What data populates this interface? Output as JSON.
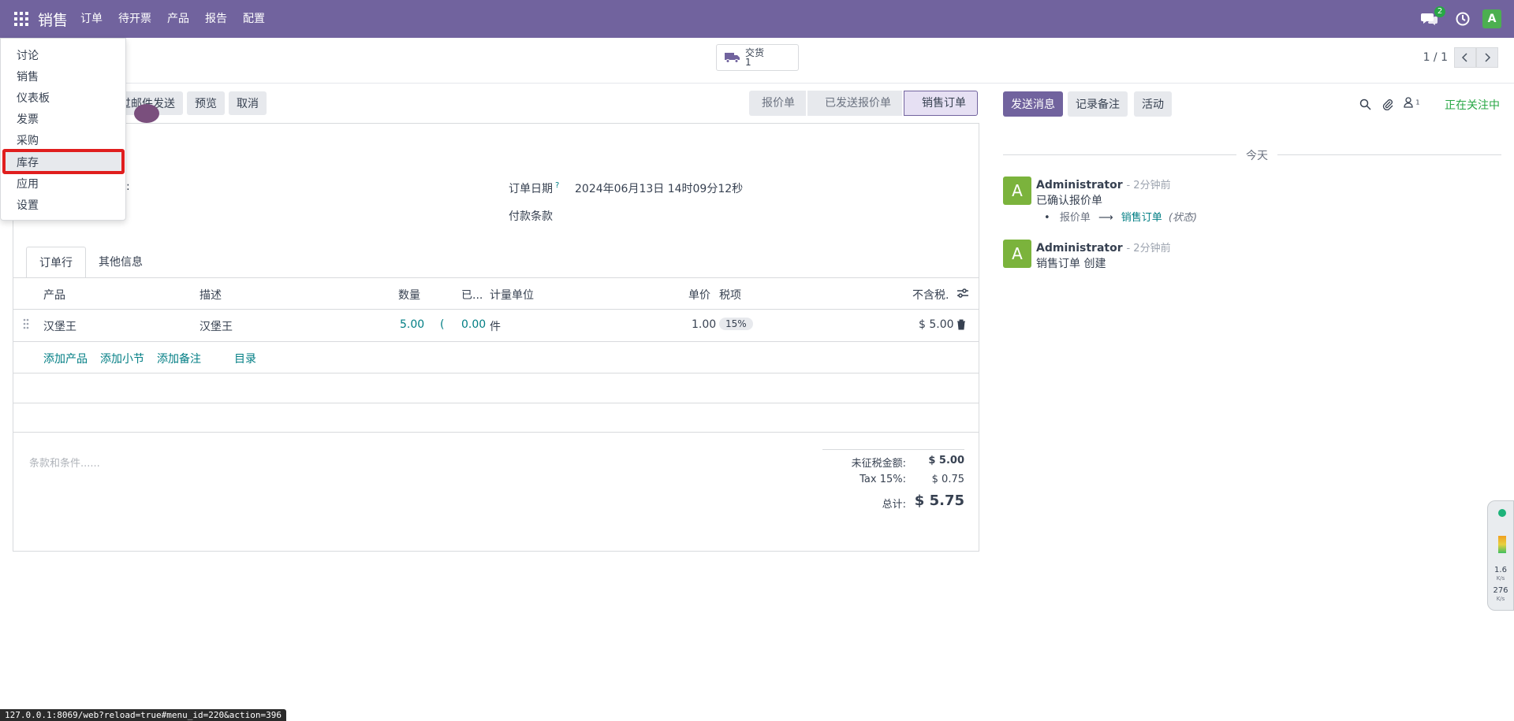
{
  "topbar": {
    "brand": "销售",
    "menu": [
      "订单",
      "待开票",
      "产品",
      "报告",
      "配置"
    ],
    "chat_count": "2",
    "user_initial": "A",
    "accent": "#71639e"
  },
  "control_panel": {
    "smart_button_label": "交货",
    "smart_button_value": "1",
    "pager_value": "1 / 1"
  },
  "statusbar": {
    "email_button": "通过邮件发送",
    "preview_button": "预览",
    "cancel_button": "取消",
    "stages": [
      "报价单",
      "已发送报价单",
      "销售订单"
    ],
    "active_stage": "销售订单"
  },
  "form": {
    "order_date_label": "订单日期",
    "order_date_help": "?",
    "order_date_value": "2024年06月13日 14时09分12秒",
    "payment_terms_label": "付款条款",
    "tabs": [
      "订单行",
      "其他信息"
    ],
    "columns": {
      "product": "产品",
      "description": "描述",
      "quantity": "数量",
      "delivered": "已...",
      "uom": "计量单位",
      "unit_price": "单价",
      "taxes": "税项",
      "subtotal": "不含税."
    },
    "lines": [
      {
        "product": "汉堡王",
        "description": "汉堡王",
        "quantity": "5.00",
        "delivered": "0.00",
        "uom": "件",
        "unit_price": "1.00",
        "tax": "15%",
        "subtotal": "$ 5.00"
      }
    ],
    "add_links": [
      "添加产品",
      "添加小节",
      "添加备注",
      "目录"
    ],
    "terms_placeholder": "条款和条件......",
    "totals": {
      "untaxed_label": "未征税金额:",
      "untaxed_value": "$ 5.00",
      "tax_label": "Tax 15%:",
      "tax_value": "$ 0.75",
      "total_label": "总计:",
      "total_value": "$ 5.75"
    }
  },
  "chatter": {
    "send_message": "发送消息",
    "log_note": "记录备注",
    "activity": "活动",
    "follower_count": "1",
    "following": "正在关注中",
    "today": "今天",
    "messages": [
      {
        "author": "Administrator",
        "time": "- 2分钟前",
        "body": "已确认报价单",
        "tracking_from": "报价单",
        "tracking_to": "销售订单",
        "tracking_field": "(状态)",
        "initial": "A"
      },
      {
        "author": "Administrator",
        "time": "- 2分钟前",
        "body": "销售订单 创建",
        "initial": "A"
      }
    ]
  },
  "dropdown": {
    "items": [
      "讨论",
      "销售",
      "仪表板",
      "发票",
      "采购",
      "库存",
      "应用",
      "设置"
    ],
    "highlighted": "库存"
  },
  "status_url": "127.0.0.1:8069/web?reload=true#menu_id=220&action=396",
  "side_widget": {
    "upload_speed": "1.6",
    "upload_unit": "K/s",
    "download_speed": "276",
    "download_unit": "K/s"
  }
}
